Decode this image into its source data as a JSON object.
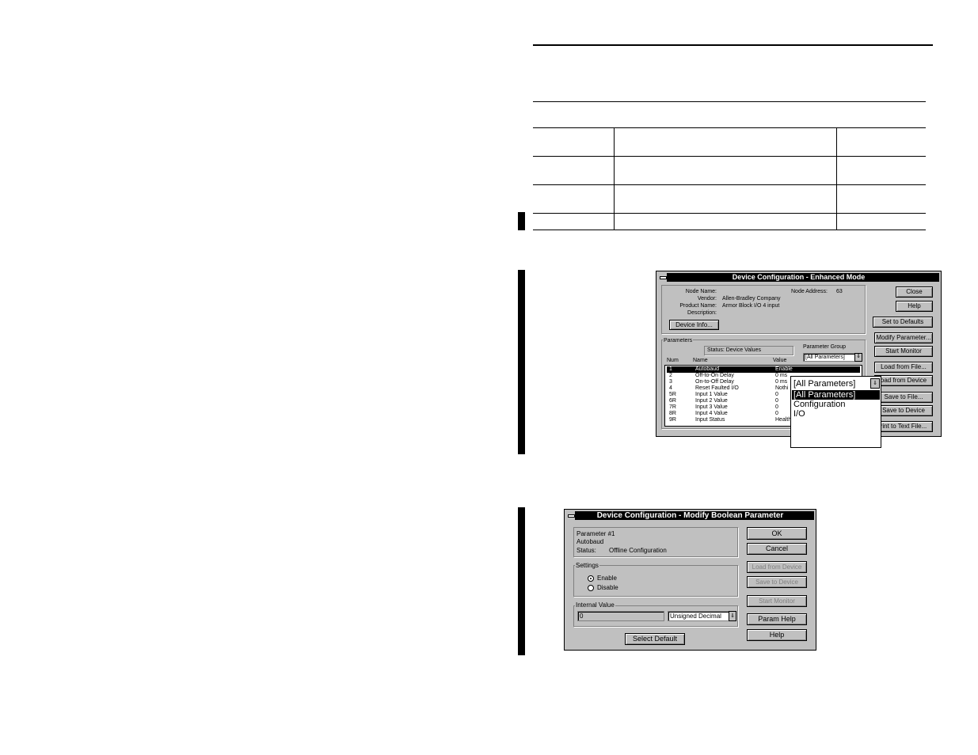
{
  "enhanced": {
    "title": "Device Configuration - Enhanced Mode",
    "node_name_label": "Node Name:",
    "vendor_label": "Vendor:",
    "vendor_value": "Allen-Bradley Company",
    "product_label": "Product Name:",
    "product_value": "Armor Block I/O  4 input",
    "description_label": "Description:",
    "node_address_label": "Node Address:",
    "node_address_value": "63",
    "device_info_button": "Device Info...",
    "parameters_label": "Parameters",
    "status_text": "Status: Device Values",
    "param_group_label": "Parameter Group",
    "param_group_value": "[All Parameters]",
    "columns": {
      "num": "Num",
      "name": "Name",
      "value": "Value"
    },
    "rows": [
      {
        "num": "1",
        "name": "Autobaud",
        "value": "Enable"
      },
      {
        "num": "2",
        "name": "Off-to-On Delay",
        "value": "0 ms"
      },
      {
        "num": "3",
        "name": "On-to-Off Delay",
        "value": "0 ms"
      },
      {
        "num": "4",
        "name": "Reset Faulted I/O",
        "value": "Nothi"
      },
      {
        "num": "5R",
        "name": "Input 1 Value",
        "value": "0"
      },
      {
        "num": "6R",
        "name": "Input 2 Value",
        "value": "0"
      },
      {
        "num": "7R",
        "name": "Input 3 Value",
        "value": "0"
      },
      {
        "num": "8R",
        "name": "Input 4 Value",
        "value": "0"
      },
      {
        "num": "9R",
        "name": "Input Status",
        "value": "Health"
      }
    ],
    "buttons": {
      "close": "Close",
      "help": "Help",
      "set_defaults": "Set to Defaults",
      "modify_parameter": "Modify Parameter...",
      "start_monitor": "Start Monitor",
      "load_from_file": "Load from File...",
      "load_from_device": "oad from Device",
      "save_to_file": "Save to File...",
      "save_to_device": "Save to Device",
      "print_text": "rint to Text File..."
    },
    "dropdown": {
      "selected": "[All Parameters]",
      "options": [
        "[All Parameters]",
        "Configuration",
        "I/O"
      ]
    }
  },
  "modify": {
    "title": "Device Configuration - Modify Boolean Parameter",
    "param_number": "Parameter #1",
    "param_name": "Autobaud",
    "status_label": "Status:",
    "status_value": "Offline Configuration",
    "settings_label": "Settings",
    "enable_label": "Enable",
    "disable_label": "Disable",
    "internal_value_label": "Internal Value",
    "internal_value": "0",
    "format_value": "Unsigned Decimal",
    "select_default": "Select Default",
    "buttons": {
      "ok": "OK",
      "cancel": "Cancel",
      "load_from_device": "Load from Device",
      "save_to_device": "Save to Device",
      "start_monitor": "Start Monitor",
      "param_help": "Param Help",
      "help": "Help"
    }
  }
}
